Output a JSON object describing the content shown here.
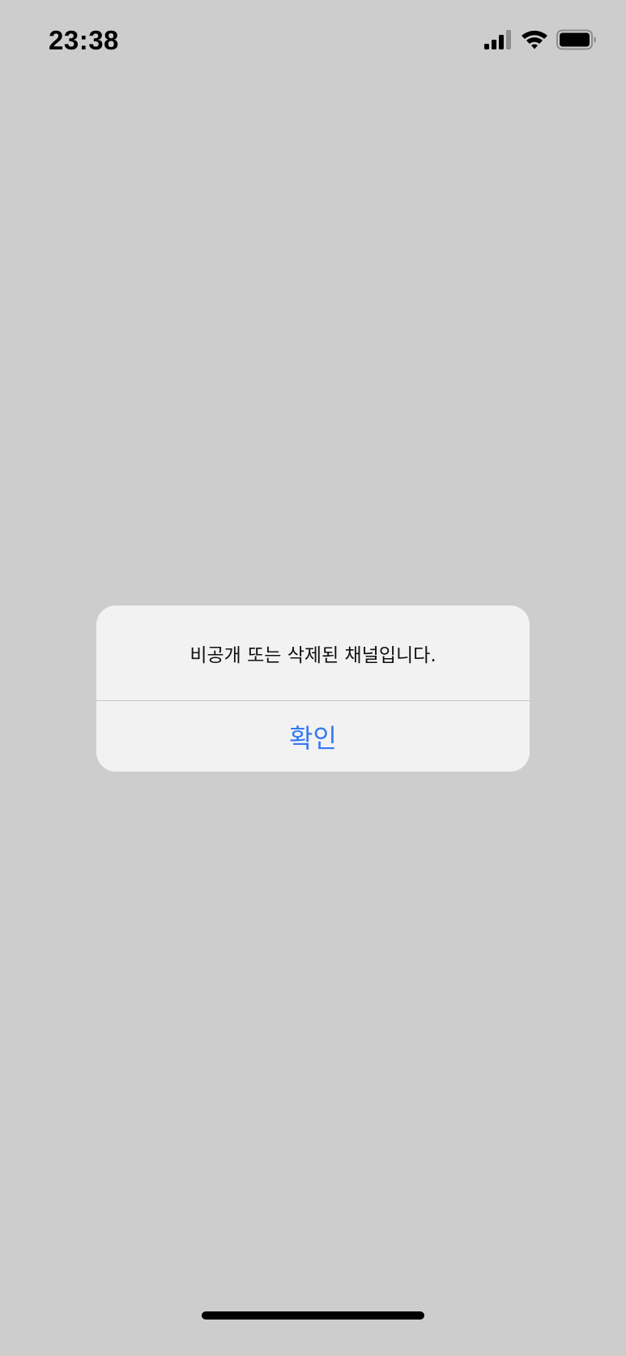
{
  "status_bar": {
    "time": "23:38",
    "signal_icon": "cellular-signal-icon",
    "wifi_icon": "wifi-icon",
    "battery_icon": "battery-icon"
  },
  "alert": {
    "message": "비공개 또는 삭제된 채널입니다.",
    "confirm_label": "확인"
  },
  "colors": {
    "background": "#cdcdcd",
    "dialog": "#f2f2f2",
    "accent": "#3478f6"
  }
}
